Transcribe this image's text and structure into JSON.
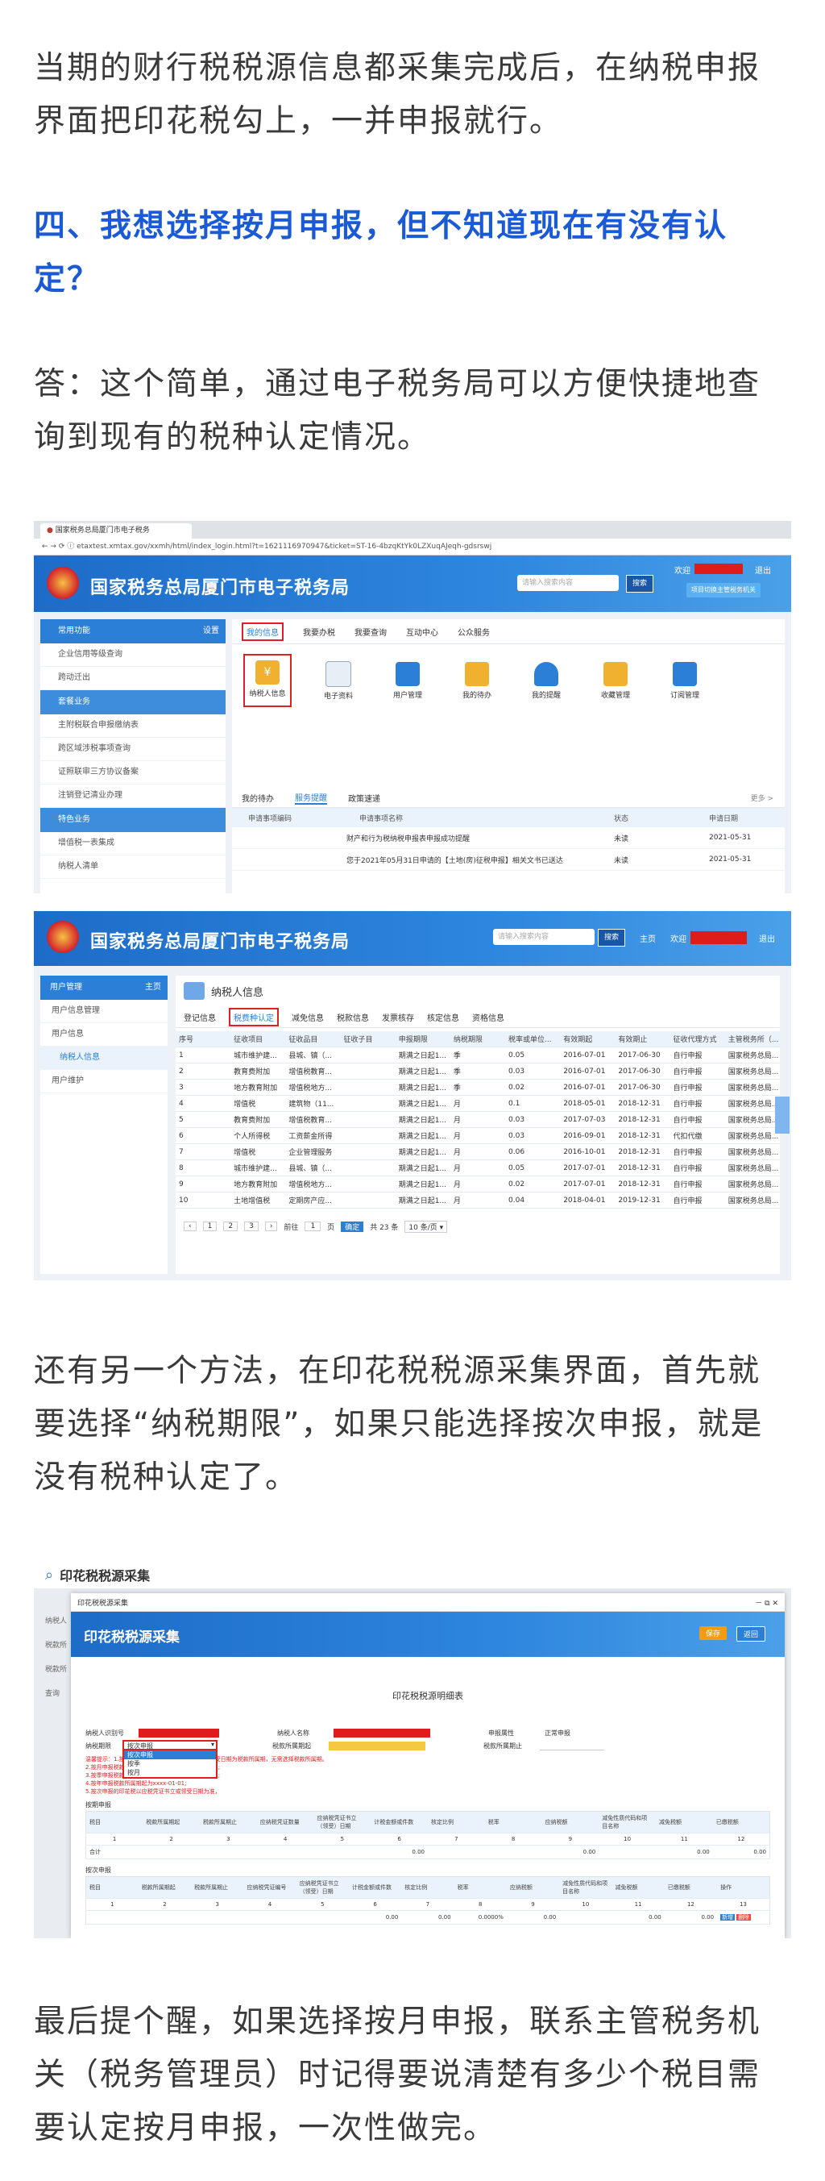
{
  "paragraphs": {
    "p1": "当期的财行税税源信息都采集完成后，在纳税申报界面把印花税勾上，一并申报就行。",
    "h4": "四、我想选择按月申报，但不知道现在有没有认定？",
    "p2": "答：这个简单，通过电子税务局可以方便快捷地查询到现有的税种认定情况。",
    "p3": "还有另一个方法，在印花税税源采集界面，首先就要选择“纳税期限”，如果只能选择按次申报，就是没有税种认定了。",
    "p4": "最后提个醒，如果选择按月申报，联系主管税务机关（税务管理员）时记得要说清楚有多少个税目需要认定按月申报，一次性做完。"
  },
  "shot1": {
    "tab_title": "国家税务总局厦门市电子税务",
    "url": "etaxtest.xmtax.gov/xxmh/html/index_login.html?t=1621116970947&ticket=ST-16-4bzqKtYk0LZXuqAJeqh-gdsrswj",
    "site_title": "国家税务总局厦门市电子税务局",
    "search_placeholder": "请输入搜索内容",
    "search_button": "搜索",
    "welcome": "欢迎",
    "logout": "退出",
    "switch_button": "项目切换主管税务机关",
    "sidebar_head": "常用功能",
    "sidebar_setting": "设置",
    "sidebar_items": [
      "企业信用等级查询",
      "跨动迁出",
      "套餐业务",
      "主附税联合申报缴纳表",
      "跨区域涉税事项查询",
      "证照联审三方协议备案",
      "注销登记清业办理",
      "特色业务",
      "增值税一表集成",
      "纳税人清单"
    ],
    "tabs": [
      "我的信息",
      "我要办税",
      "我要查询",
      "互动中心",
      "公众服务"
    ],
    "icons": [
      "纳税人信息",
      "电子资料",
      "用户管理",
      "我的待办",
      "我的提醒",
      "收藏管理",
      "订阅管理"
    ],
    "sub_tabs": [
      "我的待办",
      "服务提醒",
      "政策速递"
    ],
    "more": "更多 >",
    "notice_cols": [
      "申请事项编码",
      "申请事项名称",
      "状态",
      "申请日期"
    ],
    "notice_rows": [
      {
        "name": "财产和行为税纳税申报表申报成功提醒",
        "status": "未读",
        "date": "2021-05-31"
      },
      {
        "name": "您于2021年05月31日申请的【土地(房)征税申报】相关文书已送达",
        "status": "未读",
        "date": "2021-05-31"
      }
    ]
  },
  "shot2": {
    "site_title": "国家税务总局厦门市电子税务局",
    "search_placeholder": "请输入搜索内容",
    "search_button": "搜索",
    "home": "主页",
    "welcome": "欢迎",
    "logout": "退出",
    "side_head": "用户管理",
    "side_home": "主页",
    "side_items": [
      "用户信息管理",
      "用户信息",
      "纳税人信息",
      "用户维护"
    ],
    "panel_title": "纳税人信息",
    "tabs": [
      "登记信息",
      "税费种认定",
      "减免信息",
      "税款信息",
      "发票核存",
      "核定信息",
      "资格信息"
    ],
    "cols": [
      "序号",
      "征收项目",
      "征收品目",
      "征收子目",
      "申报期限",
      "纳税期限",
      "税率或单位...",
      "有效期起",
      "有效期止",
      "征收代理方式",
      "主管税务所（..."
    ],
    "rows": [
      [
        "1",
        "城市维护建...",
        "县城、镇（...",
        "",
        "期满之日起1...",
        "季",
        "0.05",
        "2016-07-01",
        "2017-06-30",
        "自行申报",
        "国家税务总局..."
      ],
      [
        "2",
        "教育费附加",
        "增值税教育...",
        "",
        "期满之日起1...",
        "季",
        "0.03",
        "2016-07-01",
        "2017-06-30",
        "自行申报",
        "国家税务总局..."
      ],
      [
        "3",
        "地方教育附加",
        "增值税地方...",
        "",
        "期满之日起1...",
        "季",
        "0.02",
        "2016-07-01",
        "2017-06-30",
        "自行申报",
        "国家税务总局..."
      ],
      [
        "4",
        "增值税",
        "建筑物（11...",
        "",
        "期满之日起1...",
        "月",
        "0.1",
        "2018-05-01",
        "2018-12-31",
        "自行申报",
        "国家税务总局..."
      ],
      [
        "5",
        "教育费附加",
        "增值税教育...",
        "",
        "期满之日起1...",
        "月",
        "0.03",
        "2017-07-03",
        "2018-12-31",
        "自行申报",
        "国家税务总局..."
      ],
      [
        "6",
        "个人所得税",
        "工资薪金所得",
        "",
        "期满之日起1...",
        "月",
        "0.03",
        "2016-09-01",
        "2018-12-31",
        "代扣代缴",
        "国家税务总局..."
      ],
      [
        "7",
        "增值税",
        "企业管理服务",
        "",
        "期满之日起1...",
        "月",
        "0.06",
        "2016-10-01",
        "2018-12-31",
        "自行申报",
        "国家税务总局..."
      ],
      [
        "8",
        "城市维护建...",
        "县城、镇（...",
        "",
        "期满之日起1...",
        "月",
        "0.05",
        "2017-07-01",
        "2018-12-31",
        "自行申报",
        "国家税务总局..."
      ],
      [
        "9",
        "地方教育附加",
        "增值税地方...",
        "",
        "期满之日起1...",
        "月",
        "0.02",
        "2017-07-01",
        "2018-12-31",
        "自行申报",
        "国家税务总局..."
      ],
      [
        "10",
        "土地增值税",
        "定期房产应...",
        "",
        "期满之日起1...",
        "月",
        "0.04",
        "2018-04-01",
        "2019-12-31",
        "自行申报",
        "国家税务总局..."
      ]
    ],
    "pager": {
      "pages": [
        "1",
        "2",
        "3"
      ],
      "goto": "前往",
      "page_input": "1",
      "page_unit": "页",
      "confirm": "确定",
      "total": "共 23 条",
      "size": "10 条/页 ▾"
    }
  },
  "shot3": {
    "outer_title": "印花税税源采集",
    "dialog_tab": "印花税税源采集",
    "dialog_title": "印花税税源采集",
    "dialog_controls": "－  ⧉  ✕",
    "btn_save": "保存",
    "btn_back": "返回",
    "side_labels": [
      "纳税人",
      "税款所",
      "税款所",
      "查询"
    ],
    "form_title": "印花税税源明细表",
    "fields": [
      {
        "label": "纳税人识别号",
        "value": ""
      },
      {
        "label": "纳税人名称",
        "value": ""
      },
      {
        "label": "申报属性",
        "value": "正常申报"
      },
      {
        "label": "纳税期限",
        "value": "按次申报"
      },
      {
        "label": "税款所属期起",
        "value": ""
      },
      {
        "label": "税款所属期止",
        "value": ""
      }
    ],
    "dropdown_options": [
      "按次申报",
      "按季",
      "按月"
    ],
    "notes": [
      "温馨提示：1.按次申报的印花税以应税凭证书立或领受日期为税款所属期，无需选择税款所属期。",
      "2.按月申报税款所属期起为xxxx-01-01,xxxx-01-31;",
      "3.按季申报税款所属期起为xxxx-01-01,xxxx-03-31;",
      "4.按年申报税款所属期起为xxxx-01-01;",
      "5.按次申报的印花税以应税凭证书立或领受日期为准，"
    ],
    "section1": "按期申报",
    "section2": "按次申报",
    "t1_cols": [
      "税目",
      "税款所属期起",
      "税款所属期止",
      "应纳税凭证数量",
      "应纳税凭证书立（领受）日期",
      "计税金额或件数",
      "核定比例",
      "税率",
      "应纳税额",
      "减免性质代码和项目名称",
      "减免税额",
      "已缴税额"
    ],
    "t1_nums": [
      "1",
      "2",
      "3",
      "4",
      "5",
      "6",
      "7",
      "8",
      "9",
      "10",
      "11",
      "12"
    ],
    "t1_total": "合计",
    "t1_zero": "0.00",
    "t2_cols": [
      "税目",
      "税款所属期起",
      "税款所属期止",
      "应纳税凭证编号",
      "应纳税凭证书立（领受）日期",
      "计税金额或件数",
      "核定比例",
      "税率",
      "应纳税额",
      "减免性质代码和项目名称",
      "减免税额",
      "已缴税额",
      "操作"
    ],
    "t2_nums": [
      "1",
      "2",
      "3",
      "4",
      "5",
      "6",
      "7",
      "8",
      "9",
      "10",
      "11",
      "12",
      "13"
    ],
    "t2_vals": [
      "0.00",
      "0.00",
      "0.0000%",
      "0.00",
      "0.00",
      "0.00"
    ],
    "add": "新增",
    "del": "删除",
    "detail": "明细"
  }
}
